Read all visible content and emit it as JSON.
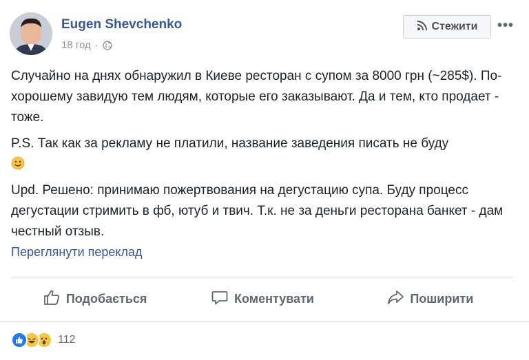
{
  "author": {
    "name": "Eugen Shevchenko"
  },
  "meta": {
    "time": "18 год",
    "separator": "·",
    "privacy_icon": "globe-icon"
  },
  "follow_button": {
    "label": "Стежити",
    "icon": "rss-icon"
  },
  "more_menu": {
    "label": "•••"
  },
  "post": {
    "paragraph1": "Случайно на днях обнаружил в Киеве ресторан с супом за 8000 грн (~285$). По-хорошему завидую тем людям, которые его заказывают. Да и тем, кто продает - тоже.",
    "paragraph2": "P.S. Так как за рекламу не платили, название заведения писать не буду",
    "paragraph3": "Upd. Решено: принимаю пожертвования на дегустацию супа. Буду процесс дегустации стримить в фб, ютуб и твич. Т.к. не за деньги ресторана банкет - дам честный отзыв."
  },
  "translate_link": "Переглянути переклад",
  "actions": {
    "like": "Подобається",
    "comment": "Коментувати",
    "share": "Поширити"
  },
  "reactions": {
    "types": [
      "like",
      "haha",
      "wow"
    ],
    "count": "112"
  },
  "colors": {
    "link": "#365899",
    "text": "#1d2129",
    "muted": "#606770",
    "like_blue": "#2078f4",
    "emoji_yellow": "#f7c544"
  }
}
